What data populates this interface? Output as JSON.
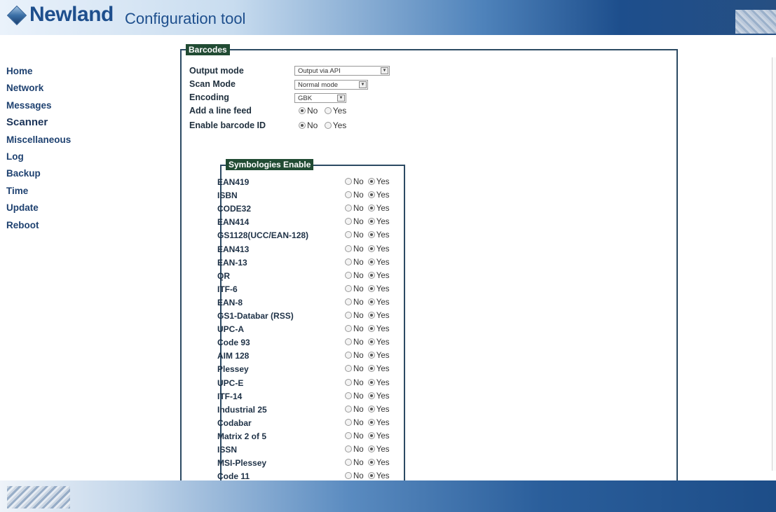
{
  "header": {
    "logo": "Newland",
    "title": "Configuration tool"
  },
  "nav": [
    {
      "label": "Home"
    },
    {
      "label": "Network"
    },
    {
      "label": "Messages"
    },
    {
      "label": "Scanner",
      "active": true
    },
    {
      "label": "Miscellaneous"
    },
    {
      "label": "Log"
    },
    {
      "label": "Backup"
    },
    {
      "label": "Time"
    },
    {
      "label": "Update"
    },
    {
      "label": "Reboot"
    }
  ],
  "barcodes": {
    "legend": "Barcodes",
    "output_mode": {
      "label": "Output mode",
      "value": "Output via API"
    },
    "scan_mode": {
      "label": "Scan Mode",
      "value": "Normal mode"
    },
    "encoding": {
      "label": "Encoding",
      "value": "GBK"
    },
    "line_feed": {
      "label": "Add a line feed",
      "selected": "No"
    },
    "barcode_id": {
      "label": "Enable barcode ID",
      "selected": "No"
    },
    "radio_no": "No",
    "radio_yes": "Yes"
  },
  "symbologies": {
    "legend": "Symbologies Enable",
    "items": [
      {
        "name": "EAN419",
        "selected": "Yes"
      },
      {
        "name": "ISBN",
        "selected": "Yes"
      },
      {
        "name": "CODE32",
        "selected": "Yes"
      },
      {
        "name": "EAN414",
        "selected": "Yes"
      },
      {
        "name": "GS1128(UCC/EAN-128)",
        "selected": "Yes"
      },
      {
        "name": "EAN413",
        "selected": "Yes"
      },
      {
        "name": "EAN-13",
        "selected": "Yes"
      },
      {
        "name": "QR",
        "selected": "Yes"
      },
      {
        "name": "ITF-6",
        "selected": "Yes"
      },
      {
        "name": "EAN-8",
        "selected": "Yes"
      },
      {
        "name": "GS1-Databar (RSS)",
        "selected": "Yes"
      },
      {
        "name": "UPC-A",
        "selected": "Yes"
      },
      {
        "name": "Code 93",
        "selected": "Yes"
      },
      {
        "name": "AIM 128",
        "selected": "Yes"
      },
      {
        "name": "Plessey",
        "selected": "Yes"
      },
      {
        "name": "UPC-E",
        "selected": "Yes"
      },
      {
        "name": "ITF-14",
        "selected": "Yes"
      },
      {
        "name": "Industrial 25",
        "selected": "Yes"
      },
      {
        "name": "Codabar",
        "selected": "Yes"
      },
      {
        "name": "Matrix 2 of 5",
        "selected": "Yes"
      },
      {
        "name": "ISSN",
        "selected": "Yes"
      },
      {
        "name": "MSI-Plessey",
        "selected": "Yes"
      },
      {
        "name": "Code 11",
        "selected": "Yes"
      }
    ]
  }
}
